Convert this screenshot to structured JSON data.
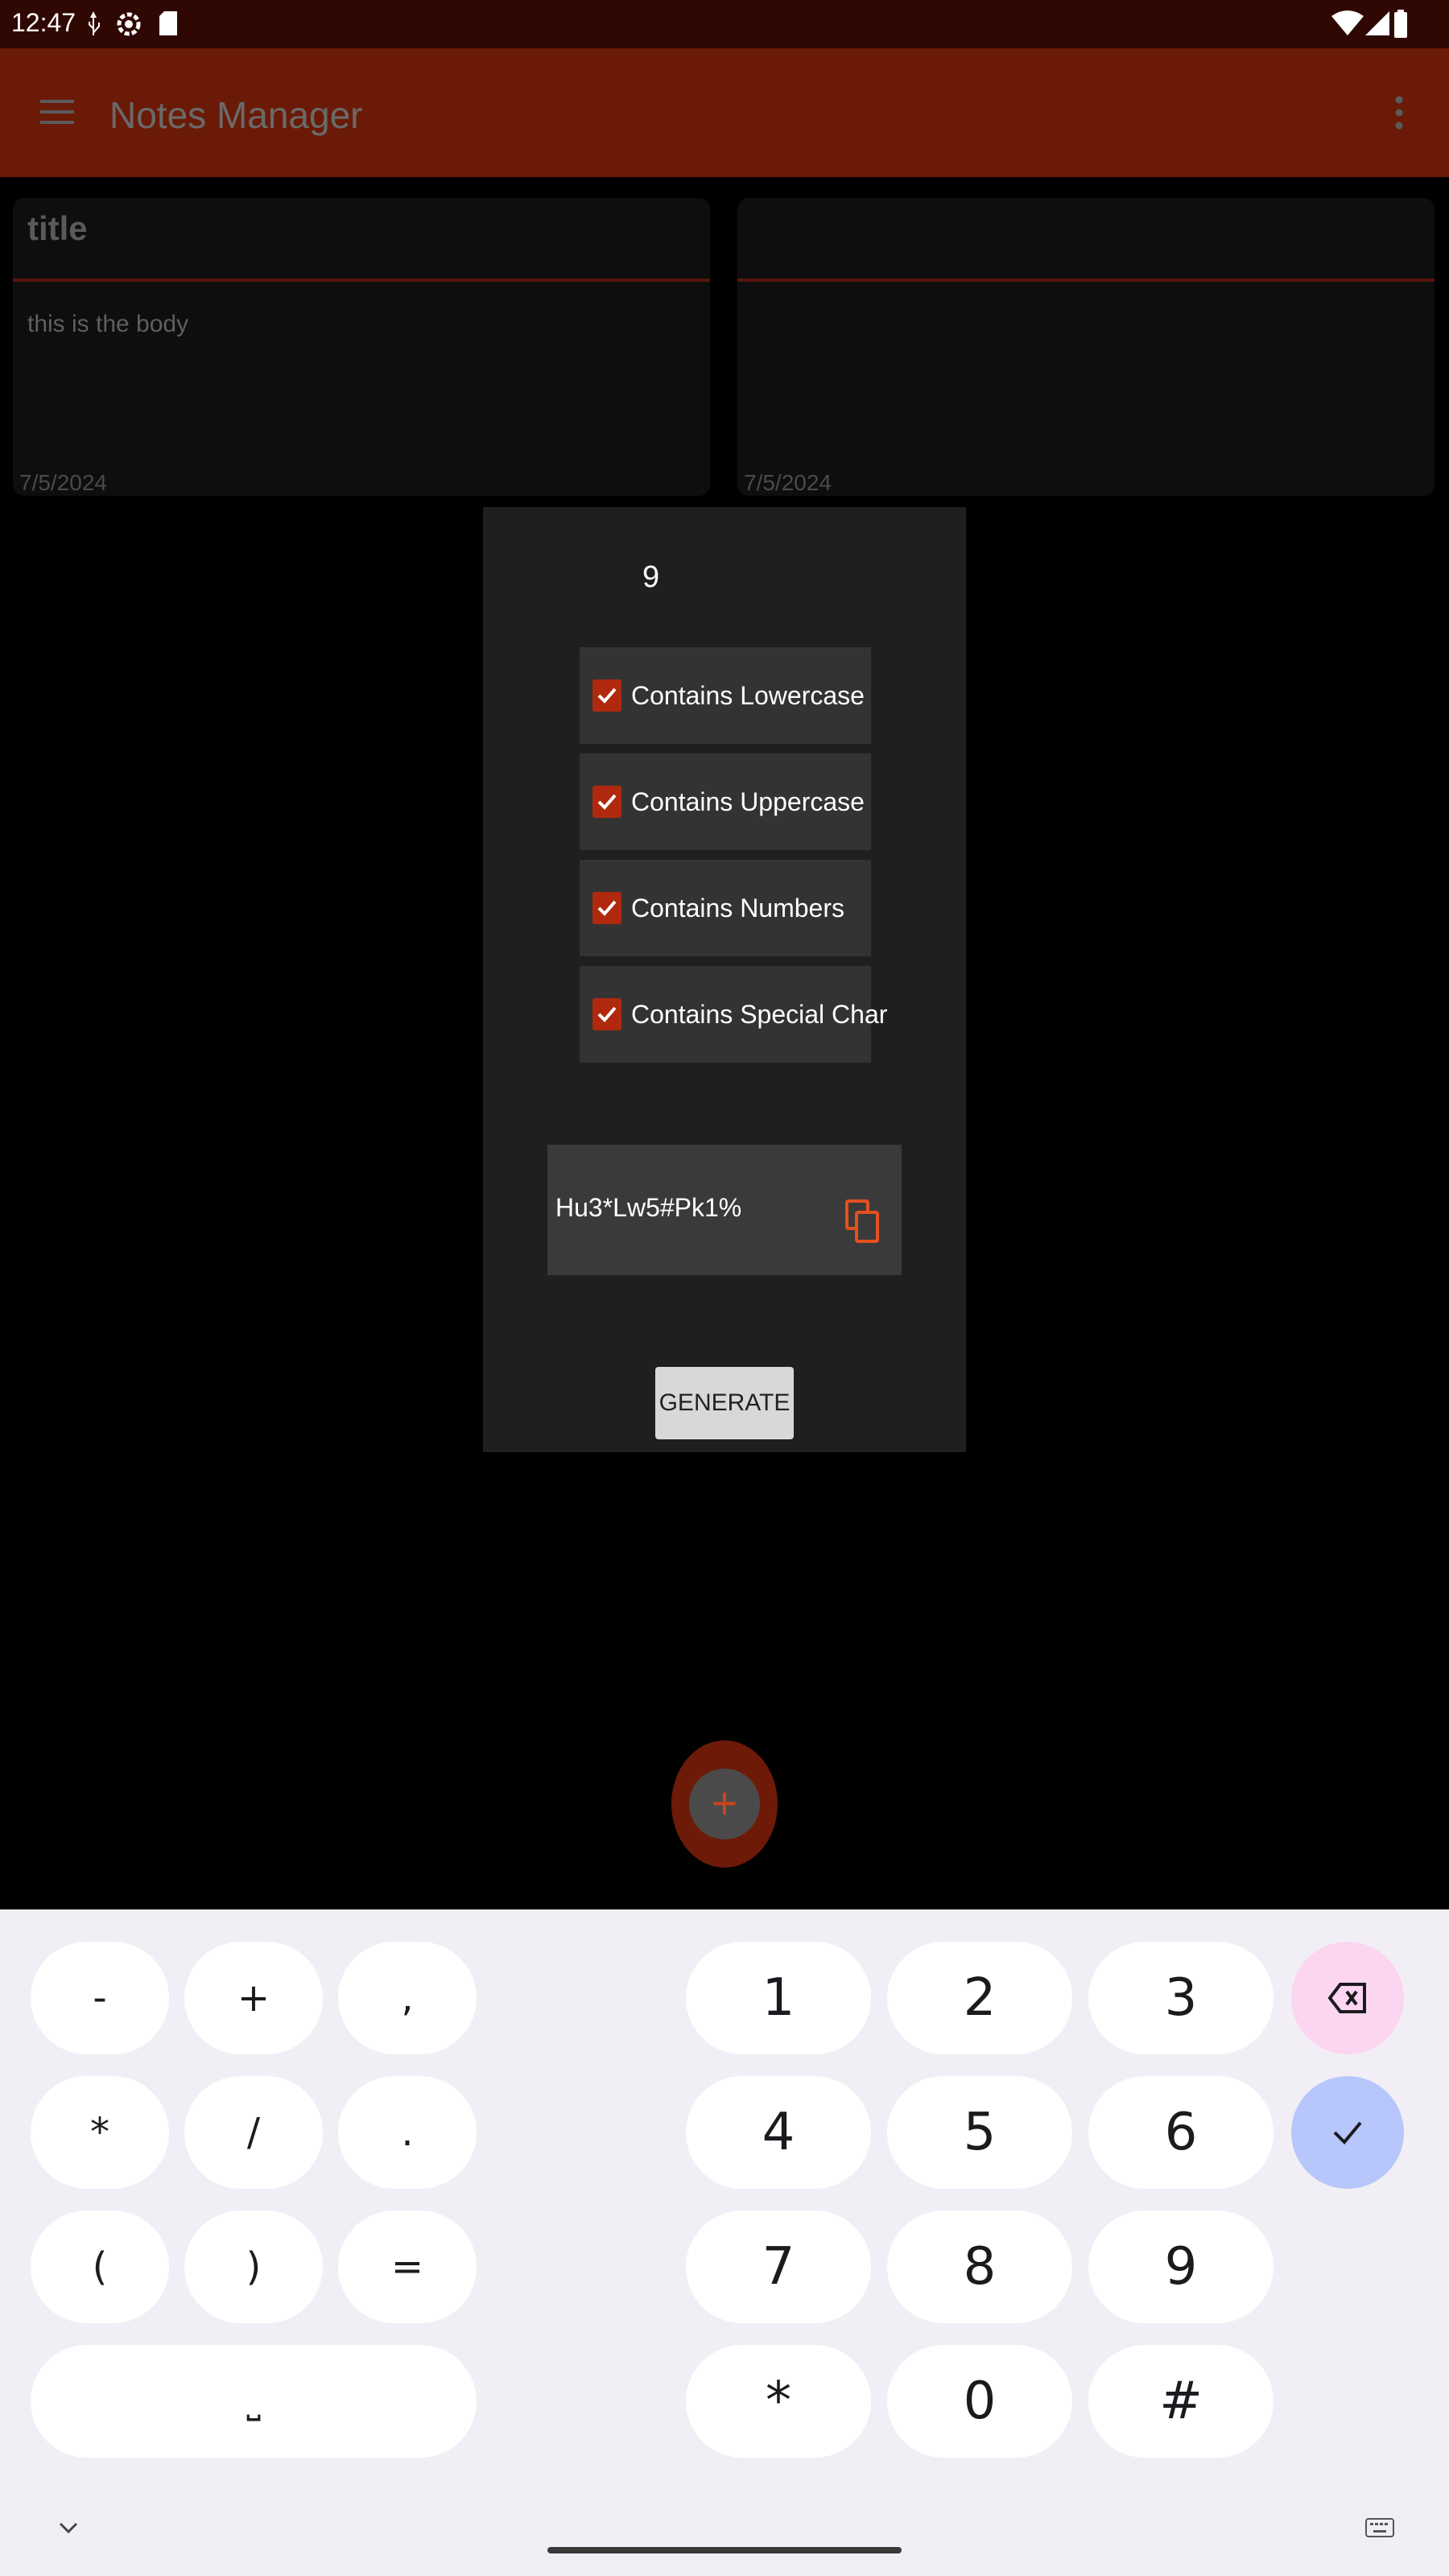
{
  "status_bar": {
    "time": "12:47"
  },
  "app_bar": {
    "title": "Notes Manager"
  },
  "notes": [
    {
      "title": "title",
      "body": "this is the body",
      "date": "7/5/2024"
    },
    {
      "title": "",
      "body": "",
      "date": "7/5/2024"
    }
  ],
  "dialog": {
    "length_value": "9",
    "options": [
      {
        "label": "Contains Lowercase",
        "checked": true
      },
      {
        "label": "Contains Uppercase",
        "checked": true
      },
      {
        "label": "Contains Numbers",
        "checked": true
      },
      {
        "label": "Contains Special Char",
        "checked": true
      }
    ],
    "generated_password": "Hu3*Lw5#Pk1%",
    "generate_label": "GENERATE"
  },
  "fab": {
    "icon": "plus-icon",
    "label": "+"
  },
  "keyboard": {
    "symbol_keys": [
      "-",
      "+",
      ",",
      "*",
      "/",
      ".",
      "(",
      ")",
      "="
    ],
    "space_key": "⎵",
    "number_keys": [
      "1",
      "2",
      "3",
      "4",
      "5",
      "6",
      "7",
      "8",
      "9",
      "*",
      "0",
      "#"
    ],
    "backspace_icon": "backspace-icon",
    "done_icon": "check-icon"
  },
  "colors": {
    "app_bar": "#6a1a07",
    "accent": "#e5501f",
    "checkbox": "#b0290e",
    "dialog_bg": "#1f1f1f",
    "keyboard_bg": "#f1eff5"
  }
}
